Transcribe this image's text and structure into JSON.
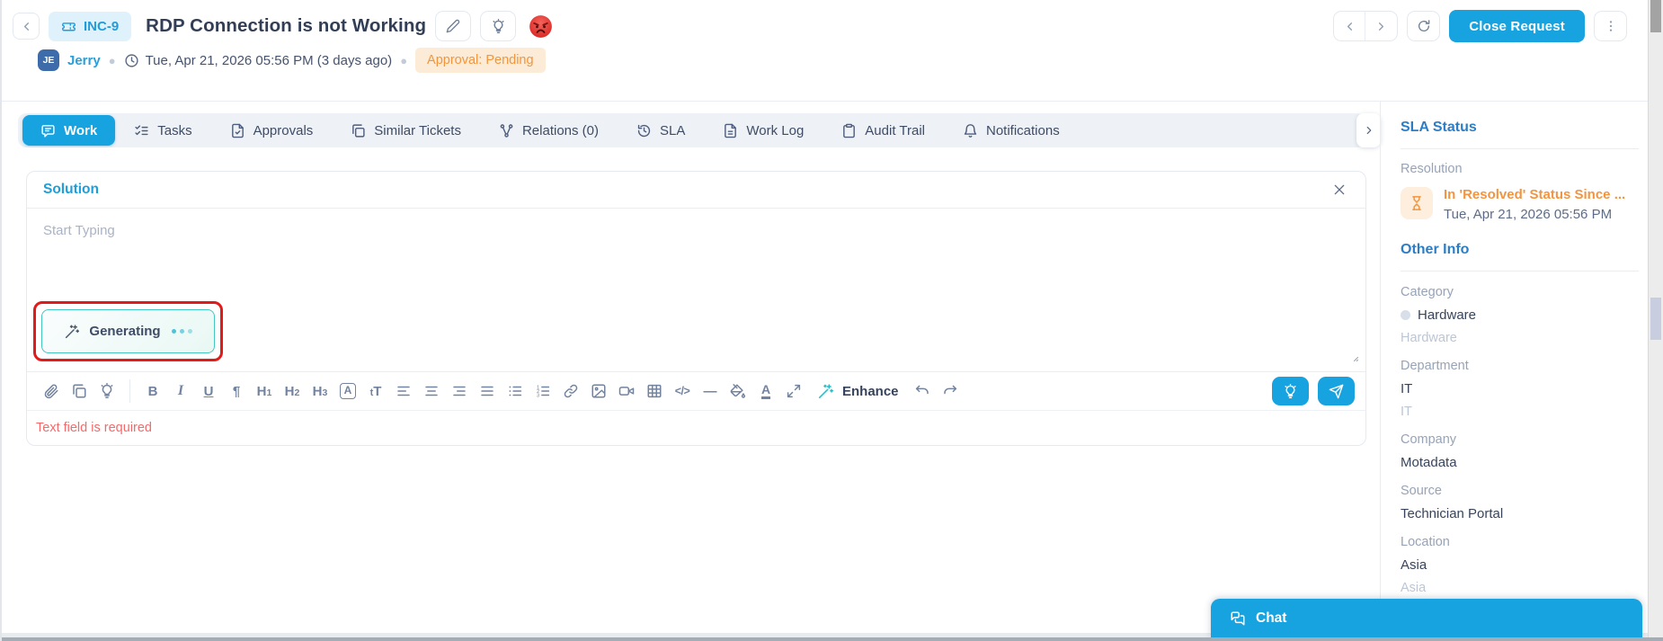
{
  "colors": {
    "accent": "#17a2e0",
    "orange": "#f2953d",
    "error_red": "#f56a6a",
    "teal": "#44c7c1",
    "annotation_red": "#e11a1a",
    "sidebar_heading_blue": "#2c7dc5"
  },
  "header": {
    "ticket_id": "INC-9",
    "title": "RDP Connection is not Working",
    "requester_initials": "JE",
    "requester_name": "Jerry",
    "timestamp": "Tue, Apr 21, 2026 05:56 PM (3 days ago)",
    "approval_badge": "Approval: Pending",
    "close_button": "Close Request",
    "sentiment_icon": "angry-face-emoji"
  },
  "tabs": [
    {
      "label": "Work",
      "icon": "message-square",
      "active": true
    },
    {
      "label": "Tasks",
      "icon": "checklist",
      "active": false
    },
    {
      "label": "Approvals",
      "icon": "doc-check",
      "active": false
    },
    {
      "label": "Similar Tickets",
      "icon": "copy",
      "active": false
    },
    {
      "label": "Relations (0)",
      "icon": "network",
      "active": false
    },
    {
      "label": "SLA",
      "icon": "history",
      "active": false
    },
    {
      "label": "Work Log",
      "icon": "file",
      "active": false
    },
    {
      "label": "Audit Trail",
      "icon": "clipboard",
      "active": false
    },
    {
      "label": "Notifications",
      "icon": "bell",
      "active": false
    }
  ],
  "solution_panel": {
    "title": "Solution",
    "placeholder": "Start Typing",
    "generating_label": "Generating",
    "enhance_label": "Enhance",
    "error_text": "Text field is required",
    "toolbar": [
      {
        "name": "attach-icon",
        "kind": "icon",
        "icon": "paperclip"
      },
      {
        "name": "templates-icon",
        "kind": "icon",
        "icon": "copy"
      },
      {
        "name": "suggestion-bulb-icon",
        "kind": "icon",
        "icon": "bulb"
      },
      {
        "kind": "divider"
      },
      {
        "name": "bold-button",
        "kind": "glyph",
        "glyph": "B"
      },
      {
        "name": "italic-button",
        "kind": "glyph",
        "glyph": "I",
        "style": "italic"
      },
      {
        "name": "underline-button",
        "kind": "glyph",
        "glyph": "U",
        "style": "underline"
      },
      {
        "name": "paragraph-button",
        "kind": "glyph",
        "glyph": "¶"
      },
      {
        "name": "heading1-button",
        "kind": "glyph",
        "glyph": "H1",
        "style": "hsub"
      },
      {
        "name": "heading2-button",
        "kind": "glyph",
        "glyph": "H2",
        "style": "hsub"
      },
      {
        "name": "heading3-button",
        "kind": "glyph",
        "glyph": "H3",
        "style": "hsub"
      },
      {
        "name": "font-style-button",
        "kind": "glyph",
        "glyph": "A",
        "style": "boxed"
      },
      {
        "name": "font-size-button",
        "kind": "glyph",
        "glyph": "tT",
        "style": "tT"
      },
      {
        "name": "align-left-button",
        "kind": "icon",
        "icon": "align-left"
      },
      {
        "name": "align-center-button",
        "kind": "icon",
        "icon": "align-center"
      },
      {
        "name": "align-right-button",
        "kind": "icon",
        "icon": "align-right"
      },
      {
        "name": "align-justify-button",
        "kind": "icon",
        "icon": "align-justify"
      },
      {
        "name": "bullet-list-button",
        "kind": "icon",
        "icon": "list-ul"
      },
      {
        "name": "ordered-list-button",
        "kind": "icon",
        "icon": "list-ol"
      },
      {
        "name": "link-button",
        "kind": "icon",
        "icon": "link"
      },
      {
        "name": "image-button",
        "kind": "icon",
        "icon": "image"
      },
      {
        "name": "video-button",
        "kind": "icon",
        "icon": "video"
      },
      {
        "name": "table-button",
        "kind": "icon",
        "icon": "table"
      },
      {
        "name": "code-button",
        "kind": "glyph",
        "glyph": "</>",
        "style": "code"
      },
      {
        "name": "horizontal-rule-button",
        "kind": "glyph",
        "glyph": "—"
      },
      {
        "name": "fill-color-button",
        "kind": "icon",
        "icon": "fill"
      },
      {
        "name": "text-color-button",
        "kind": "glyph",
        "glyph": "A",
        "style": "underbar"
      },
      {
        "name": "fullscreen-button",
        "kind": "icon",
        "icon": "expand"
      },
      {
        "name": "enhance-button",
        "kind": "enhance"
      },
      {
        "name": "undo-button",
        "kind": "icon",
        "icon": "undo"
      },
      {
        "name": "redo-button",
        "kind": "icon",
        "icon": "redo"
      }
    ]
  },
  "sidebar": {
    "sla_status": {
      "heading": "SLA Status",
      "resolution_label": "Resolution",
      "status_text": "In 'Resolved' Status Since ...",
      "status_time": "Tue, Apr 21, 2026 05:56 PM"
    },
    "other_info": {
      "heading": "Other Info",
      "fields": [
        {
          "label": "Category",
          "value": "Hardware",
          "sub": "Hardware",
          "dot": true
        },
        {
          "label": "Department",
          "value": "IT",
          "sub": "IT"
        },
        {
          "label": "Company",
          "value": "Motadata"
        },
        {
          "label": "Source",
          "value": "Technician Portal"
        },
        {
          "label": "Location",
          "value": "Asia",
          "sub": "Asia"
        }
      ]
    }
  },
  "chat": {
    "label": "Chat"
  }
}
